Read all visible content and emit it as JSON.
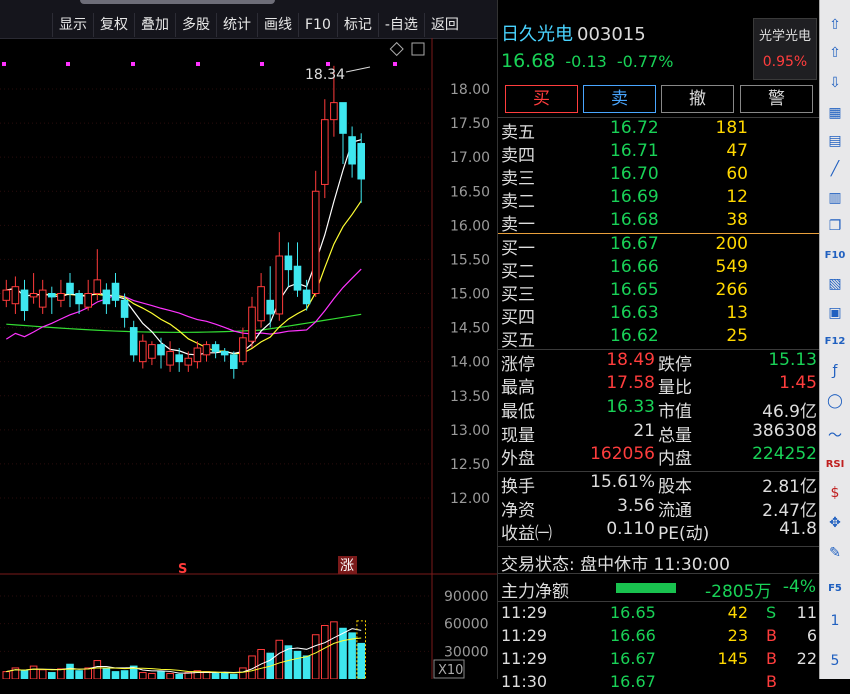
{
  "toolbar": {
    "buttons": [
      "显示",
      "复权",
      "叠加",
      "多股",
      "统计",
      "画线",
      "F10",
      "标记",
      "-自选",
      "返回"
    ]
  },
  "chart": {
    "price_ticks": [
      "18.00",
      "17.50",
      "17.00",
      "16.50",
      "16.00",
      "15.50",
      "15.00",
      "14.50",
      "14.00",
      "13.50",
      "13.00",
      "12.50",
      "12.00"
    ],
    "high_marker": "18.34",
    "volume_ticks": [
      "90000",
      "60000",
      "30000"
    ],
    "volume_unit": "X10",
    "markers": [
      "S",
      "涨"
    ],
    "colors": {
      "up": "#ff3b3b",
      "down": "#3ee7ef",
      "ma5": "#ffffff",
      "ma10": "#ffff33",
      "ma20": "#ff33ff",
      "ma60": "#33dd33",
      "grid": "#7a1a1a"
    }
  },
  "quote": {
    "name": "日久光电",
    "code": "003015",
    "price": "16.68",
    "change": "-0.13",
    "change_pct": "-0.77%",
    "concept_name": "光学光电",
    "concept_pct": "0.95%",
    "btn_buy": "买",
    "btn_sell": "卖",
    "btn_cancel": "撤",
    "btn_alert": "警"
  },
  "order_book": {
    "asks": [
      {
        "label": "卖五",
        "price": "16.72",
        "vol": "181"
      },
      {
        "label": "卖四",
        "price": "16.71",
        "vol": "47"
      },
      {
        "label": "卖三",
        "price": "16.70",
        "vol": "60"
      },
      {
        "label": "卖二",
        "price": "16.69",
        "vol": "12"
      },
      {
        "label": "卖一",
        "price": "16.68",
        "vol": "38"
      }
    ],
    "bids": [
      {
        "label": "买一",
        "price": "16.67",
        "vol": "200"
      },
      {
        "label": "买二",
        "price": "16.66",
        "vol": "549"
      },
      {
        "label": "买三",
        "price": "16.65",
        "vol": "266"
      },
      {
        "label": "买四",
        "price": "16.63",
        "vol": "13"
      },
      {
        "label": "买五",
        "price": "16.62",
        "vol": "25"
      }
    ]
  },
  "stats": [
    {
      "l1": "涨停",
      "v1": "18.49",
      "c1": "red",
      "l2": "跌停",
      "v2": "15.13",
      "c2": "green"
    },
    {
      "l1": "最高",
      "v1": "17.58",
      "c1": "red",
      "l2": "量比",
      "v2": "1.45",
      "c2": "red"
    },
    {
      "l1": "最低",
      "v1": "16.33",
      "c1": "green",
      "l2": "市值",
      "v2": "46.9亿",
      "c2": "white"
    },
    {
      "l1": "现量",
      "v1": "21",
      "c1": "white",
      "l2": "总量",
      "v2": "386308",
      "c2": "white"
    },
    {
      "l1": "外盘",
      "v1": "162056",
      "c1": "red",
      "l2": "内盘",
      "v2": "224252",
      "c2": "green"
    },
    {
      "l1": "换手",
      "v1": "15.61%",
      "c1": "white",
      "l2": "股本",
      "v2": "2.81亿",
      "c2": "white"
    },
    {
      "l1": "净资",
      "v1": "3.56",
      "c1": "white",
      "l2": "流通",
      "v2": "2.47亿",
      "c2": "white"
    },
    {
      "l1": "收益㈠",
      "v1": "0.110",
      "c1": "white",
      "l2": "PE(动)",
      "v2": "41.8",
      "c2": "white"
    }
  ],
  "trade_status": "交易状态: 盘中休市 11:30:00",
  "main_force": {
    "label": "主力净额",
    "amount": "-2805万",
    "pct": "-4%"
  },
  "ticks": [
    {
      "time": "11:29",
      "price": "16.65",
      "vol": "42",
      "dir": "S",
      "num": "11"
    },
    {
      "time": "11:29",
      "price": "16.66",
      "vol": "23",
      "dir": "B",
      "num": "6"
    },
    {
      "time": "11:29",
      "price": "16.67",
      "vol": "145",
      "dir": "B",
      "num": "22"
    },
    {
      "time": "11:30",
      "price": "16.67",
      "vol": "",
      "dir": "B",
      "num": ""
    }
  ],
  "sidebar": {
    "icons": [
      "up-arrow-icon",
      "up-outline-arrow-icon",
      "down-arrow-icon",
      "report-icon",
      "grid-icon",
      "line-chart-icon",
      "candle-icon",
      "copy-icon",
      "f10-icon",
      "finance-icon",
      "edit-icon",
      "f12-icon",
      "formula-icon",
      "circle-icon",
      "wave-icon",
      "rsi-icon",
      "dollar-icon",
      "move-icon",
      "pen-icon",
      "f5-icon",
      "num-icon",
      "num-icon-2"
    ],
    "labels": {
      "rsi": "RSI",
      "f5": "F5",
      "n1": "1",
      "n5": "5",
      "f10": "F10",
      "f12": "F12"
    }
  }
}
